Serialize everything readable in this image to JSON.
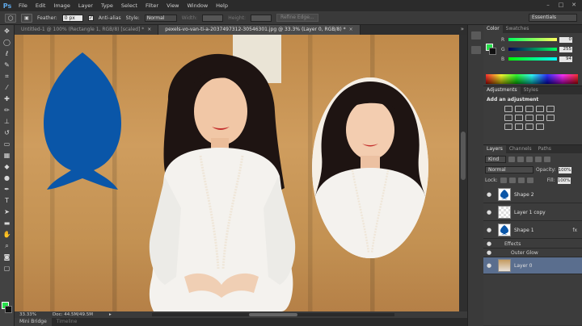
{
  "app": {
    "logo": "Ps"
  },
  "menu": [
    "File",
    "Edit",
    "Image",
    "Layer",
    "Type",
    "Select",
    "Filter",
    "View",
    "Window",
    "Help"
  ],
  "window_controls": [
    "–",
    "□",
    "✕"
  ],
  "options": {
    "feather_label": "Feather:",
    "feather_value": "0 px",
    "antialias_label": "Anti-alias",
    "antialias_check": "✓",
    "style_label": "Style:",
    "style_value": "Normal",
    "width_label": "Width:",
    "height_label": "Height:",
    "refine_label": "Refine Edge...",
    "workspace": "Essentials"
  },
  "tabs": [
    {
      "label": "Untitled-1 @ 100% (Rectangle 1, RGB/8) [scaled] *",
      "close": "×"
    },
    {
      "label": "pexels-vo-van-ti-a-2037497312-30546301.jpg @ 33.3% (Layer 0, RGB/8) *",
      "close": "×"
    }
  ],
  "tab_more": "»",
  "status": {
    "zoom": "33.33%",
    "doc": "Doc: 44.5M/49.5M",
    "arrow": "▸"
  },
  "bottom_tabs": [
    "Mini Bridge",
    "Timeline"
  ],
  "color_panel": {
    "tabs": [
      "Color",
      "Swatches"
    ],
    "r_label": "R",
    "r_value": "0",
    "g_label": "G",
    "g_value": "255",
    "b_label": "B",
    "b_value": "94",
    "fg": "#27e04b"
  },
  "adjustments": {
    "tabs": [
      "Adjustments",
      "Styles"
    ],
    "title": "Add an adjustment"
  },
  "layers": {
    "tabs": [
      "Layers",
      "Channels",
      "Paths"
    ],
    "kind": "Kind",
    "blend": "Normal",
    "opacity_label": "Opacity:",
    "opacity_value": "100%",
    "lock_label": "Lock:",
    "fill_label": "Fill:",
    "fill_value": "100%",
    "items": [
      {
        "name": "Shape 2",
        "selected": false
      },
      {
        "name": "Layer 1 copy",
        "selected": false
      },
      {
        "name": "Shape 1",
        "fx": "fx",
        "selected": false
      },
      {
        "name": "Effects"
      },
      {
        "name": "Outer Glow"
      },
      {
        "name": "Layer 0",
        "selected": true
      }
    ],
    "bottom": [
      "⊕",
      "fx",
      "◐",
      "▢",
      "▣",
      "🗑"
    ]
  },
  "shape_color": "#0a56a8"
}
